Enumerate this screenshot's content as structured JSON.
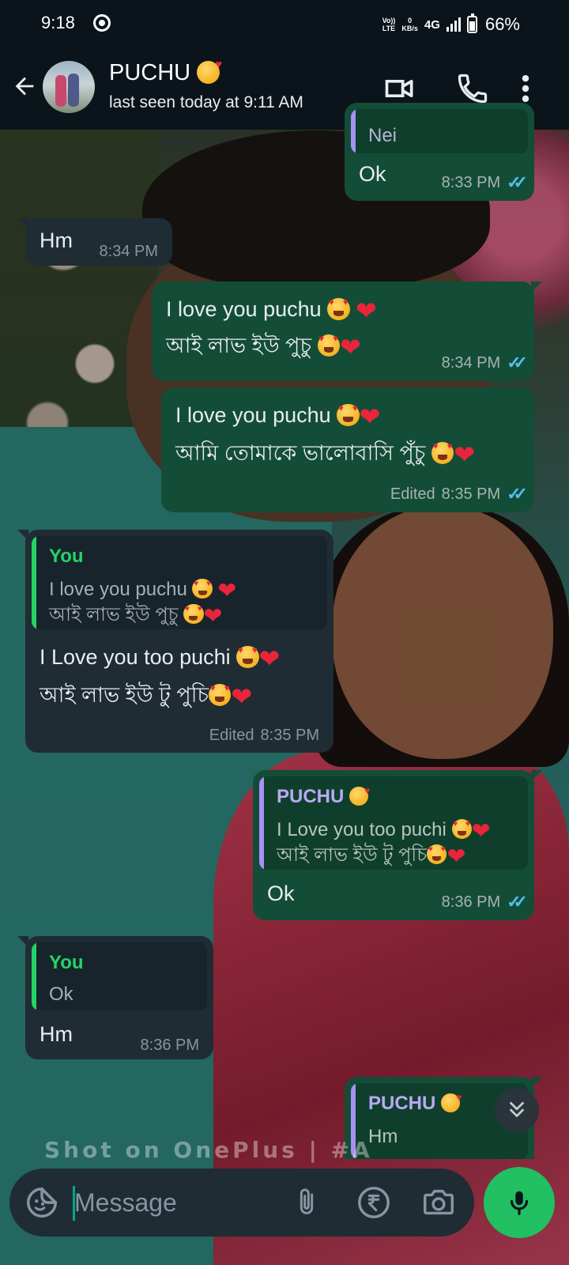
{
  "status_bar": {
    "time": "9:18",
    "volte": "Vo))\nLTE",
    "data_speed": "0\nKB/s",
    "network": "4G",
    "battery_percent": "66%"
  },
  "header": {
    "contact_name": "PUCHU",
    "contact_name_emoji": "smiling-face-with-hearts",
    "last_seen": "last seen today at 9:11 AM"
  },
  "colors": {
    "outgoing_bubble": "#144d37",
    "incoming_bubble": "#1f2c34",
    "read_ticks": "#53bdeb",
    "mic_button": "#21c063",
    "quote_you": "#25d366",
    "quote_puchu": "#a791f2"
  },
  "messages": [
    {
      "dir": "out",
      "quoted_fragment": "Nei",
      "text": "Ok",
      "time": "8:33 PM",
      "read": true
    },
    {
      "dir": "in",
      "text": "Hm",
      "time": "8:34 PM"
    },
    {
      "dir": "out",
      "line1": "I love you puchu",
      "line2": "আই লাভ ইউ পুচু",
      "time": "8:34 PM",
      "read": true
    },
    {
      "dir": "out",
      "line1": "I love you puchu",
      "line2": "আমি তোমাকে ভালোবাসি পুঁচু",
      "edited": "Edited",
      "time": "8:35 PM",
      "read": true
    },
    {
      "dir": "in",
      "quote_name": "You",
      "quote_line1": "I love you puchu",
      "quote_line2": "আই লাভ ইউ পুচু",
      "line1": "I Love you too puchi",
      "line2": "আই লাভ ইউ টু পুচি",
      "edited": "Edited",
      "time": "8:35 PM"
    },
    {
      "dir": "out",
      "quote_name": "PUCHU",
      "quote_line1": "I Love you too puchi",
      "quote_line2": "আই লাভ ইউ টু পুচি",
      "text": "Ok",
      "time": "8:36 PM",
      "read": true
    },
    {
      "dir": "in",
      "quote_name": "You",
      "quote_line1": "Ok",
      "text": "Hm",
      "time": "8:36 PM"
    },
    {
      "dir": "out",
      "quote_name": "PUCHU",
      "quote_line1": "Hm"
    }
  ],
  "watermark": "Shot on OnePlus | #A",
  "composer": {
    "placeholder": "Message"
  },
  "icons": {
    "back": "arrow-left-icon",
    "video": "video-camera-icon",
    "call": "phone-icon",
    "menu": "more-vertical-icon",
    "sticker": "sticker-icon",
    "attach": "paperclip-icon",
    "payment": "rupee-icon",
    "camera": "camera-icon",
    "mic": "microphone-icon",
    "scroll": "double-chevron-down-icon"
  }
}
